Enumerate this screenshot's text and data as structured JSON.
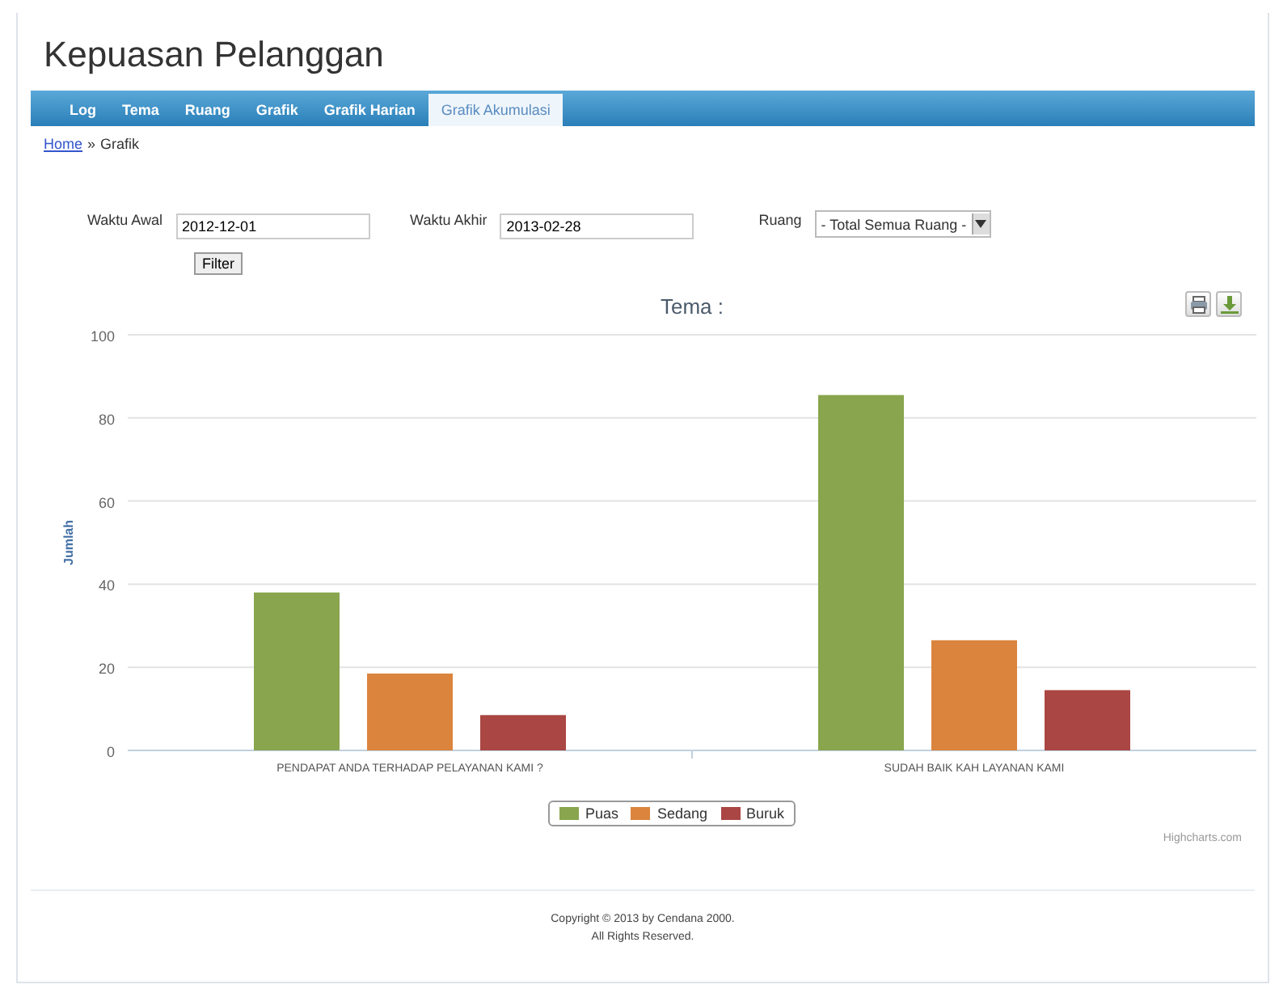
{
  "page_title": "Kepuasan Pelanggan",
  "nav": [
    {
      "label": "Log",
      "selected": false
    },
    {
      "label": "Tema",
      "selected": false
    },
    {
      "label": "Ruang",
      "selected": false
    },
    {
      "label": "Grafik",
      "selected": false
    },
    {
      "label": "Grafik Harian",
      "selected": false
    },
    {
      "label": "Grafik Akumulasi",
      "selected": true
    }
  ],
  "breadcrumb": {
    "link": "Home",
    "separator": "»",
    "current": "Grafik"
  },
  "filters": [
    {
      "kind": "date",
      "label": "Waktu Awal",
      "value": "2012-12-01"
    },
    {
      "kind": "date",
      "label": "Waktu Akhir",
      "value": "2013-02-28"
    },
    {
      "kind": "select",
      "label": "Ruang",
      "value": "- Total Semua Ruang -"
    }
  ],
  "filter_button": "Filter",
  "chart": {
    "credit": "Highcharts.com",
    "chart_data": {
      "type": "bar",
      "title": "Tema :",
      "ylabel": "Jumlah",
      "categories": [
        "PENDAPAT ANDA TERHADAP PELAYANAN KAMI ?",
        "SUDAH BAIK KAH LAYANAN KAMI"
      ],
      "series": [
        {
          "name": "Puas",
          "color": "#89a54e",
          "values": [
            38,
            85.5
          ]
        },
        {
          "name": "Sedang",
          "color": "#db843d",
          "values": [
            18.5,
            26.5
          ]
        },
        {
          "name": "Buruk",
          "color": "#aa4643",
          "values": [
            8.5,
            14.5
          ]
        }
      ],
      "grid": true,
      "legend": true,
      "ylim": [
        0,
        100
      ],
      "yticks": [
        0,
        20,
        40,
        60,
        80,
        100
      ]
    }
  },
  "footer": [
    "Copyright © 2013 by Cendana 2000.",
    "All Rights Reserved."
  ]
}
